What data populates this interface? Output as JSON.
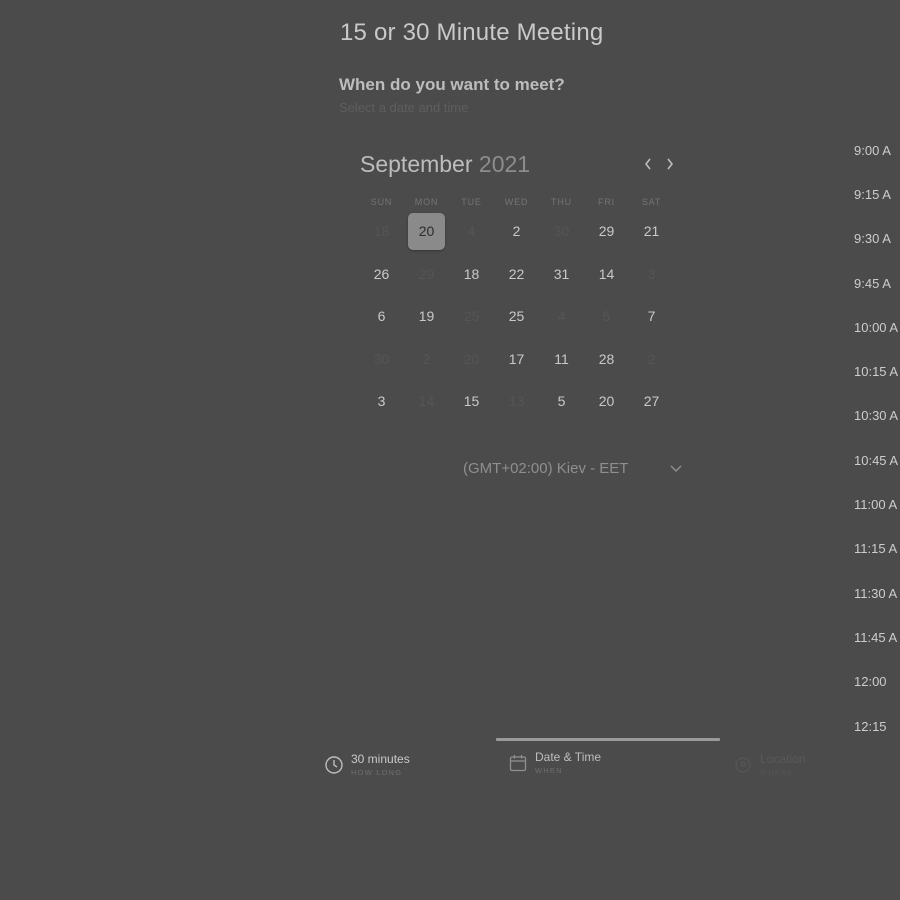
{
  "header": {
    "title": "15 or 30 Minute Meeting",
    "question": "When do you want to meet?",
    "hint": "Select a date and time"
  },
  "calendar": {
    "month": "September",
    "year": "2021",
    "weekdays": [
      "SUN",
      "MON",
      "TUE",
      "WED",
      "THU",
      "FRI",
      "SAT"
    ],
    "selected_day": "20",
    "weeks": [
      [
        {
          "d": "18",
          "s": "muted"
        },
        {
          "d": "20",
          "s": "selected"
        },
        {
          "d": "4",
          "s": "muted"
        },
        {
          "d": "2",
          "s": "active"
        },
        {
          "d": "30",
          "s": "muted"
        },
        {
          "d": "29",
          "s": "active"
        },
        {
          "d": "21",
          "s": "active"
        }
      ],
      [
        {
          "d": "26",
          "s": "active"
        },
        {
          "d": "29",
          "s": "muted"
        },
        {
          "d": "18",
          "s": "active"
        },
        {
          "d": "22",
          "s": "active"
        },
        {
          "d": "31",
          "s": "active"
        },
        {
          "d": "14",
          "s": "active"
        },
        {
          "d": "3",
          "s": "muted"
        }
      ],
      [
        {
          "d": "6",
          "s": "active"
        },
        {
          "d": "19",
          "s": "active"
        },
        {
          "d": "25",
          "s": "muted"
        },
        {
          "d": "25",
          "s": "active"
        },
        {
          "d": "4",
          "s": "muted"
        },
        {
          "d": "5",
          "s": "muted"
        },
        {
          "d": "7",
          "s": "active"
        }
      ],
      [
        {
          "d": "30",
          "s": "muted"
        },
        {
          "d": "2",
          "s": "muted"
        },
        {
          "d": "20",
          "s": "muted"
        },
        {
          "d": "17",
          "s": "active"
        },
        {
          "d": "11",
          "s": "active"
        },
        {
          "d": "28",
          "s": "active"
        },
        {
          "d": "2",
          "s": "muted"
        }
      ],
      [
        {
          "d": "3",
          "s": "active"
        },
        {
          "d": "14",
          "s": "muted"
        },
        {
          "d": "15",
          "s": "active"
        },
        {
          "d": "13",
          "s": "muted"
        },
        {
          "d": "5",
          "s": "active"
        },
        {
          "d": "20",
          "s": "active"
        },
        {
          "d": "27",
          "s": "active"
        }
      ]
    ]
  },
  "timezone": {
    "label": "(GMT+02:00) Kiev - EET",
    "icon": "chevron-down-icon"
  },
  "times": [
    "9:00 A",
    "9:15 A",
    "9:30 A",
    "9:45 A",
    "10:00 A",
    "10:15 A",
    "10:30 A",
    "10:45 A",
    "11:00 A",
    "11:15 A",
    "11:30 A",
    "11:45 A",
    "12:00",
    "12:15"
  ],
  "steps": [
    {
      "label": "30 minutes",
      "sub": "HOW LONG",
      "icon": "clock-icon"
    },
    {
      "label": "Date & Time",
      "sub": "WHEN",
      "icon": "calendar-icon"
    },
    {
      "label": "Location",
      "sub": "WHERE",
      "icon": "location-icon"
    }
  ]
}
